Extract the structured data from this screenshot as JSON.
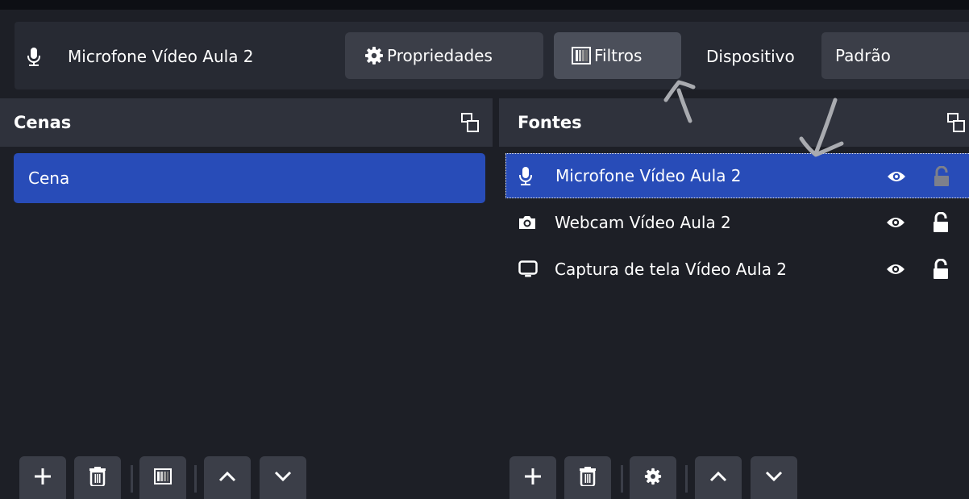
{
  "toolbar": {
    "source_name": "Microfone Vídeo Aula 2",
    "properties_label": "Propriedades",
    "filters_label": "Filtros",
    "device_label": "Dispositivo",
    "device_value": "Padrão"
  },
  "scenes": {
    "title": "Cenas",
    "items": [
      {
        "label": "Cena",
        "selected": true
      }
    ]
  },
  "sources": {
    "title": "Fontes",
    "items": [
      {
        "label": "Microfone Vídeo Aula 2",
        "icon": "microphone-icon",
        "selected": true,
        "visible": true,
        "locked": false
      },
      {
        "label": "Webcam Vídeo Aula 2",
        "icon": "camera-icon",
        "selected": false,
        "visible": true,
        "locked": false
      },
      {
        "label": "Captura de tela Vídeo Aula 2",
        "icon": "monitor-icon",
        "selected": false,
        "visible": true,
        "locked": false
      }
    ]
  },
  "colors": {
    "background": "#1d1f26",
    "panel": "#272a33",
    "header": "#2f323c",
    "button": "#3b3e48",
    "selection": "#284cb8"
  }
}
